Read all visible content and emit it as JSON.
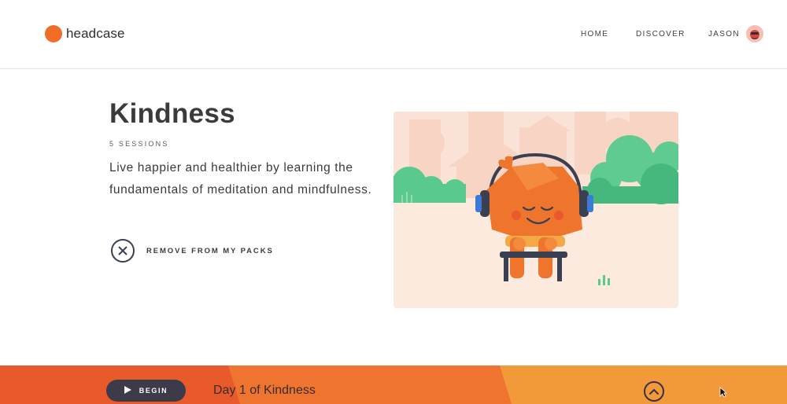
{
  "header": {
    "brand": "headcase",
    "nav": {
      "home": "HOME",
      "discover": "DISCOVER",
      "user": "JASON"
    }
  },
  "pack": {
    "title": "Kindness",
    "sessions": "5 SESSIONS",
    "description": "Live happier and healthier by learning the fundamentals of meditation and mindfulness.",
    "remove_label": "REMOVE FROM MY PACKS"
  },
  "player": {
    "begin_label": "BEGIN",
    "day_label": "Day 1 of Kindness"
  },
  "colors": {
    "brand": "#f06c27",
    "player_left": "#e85a2c",
    "player_mid": "#ef7430",
    "player_right": "#f29a3a",
    "button_dark": "#3d3a4a"
  },
  "icons": [
    "logo-dot-icon",
    "avatar-icon",
    "close-icon",
    "play-icon",
    "chevron-up-icon",
    "cursor-icon"
  ]
}
